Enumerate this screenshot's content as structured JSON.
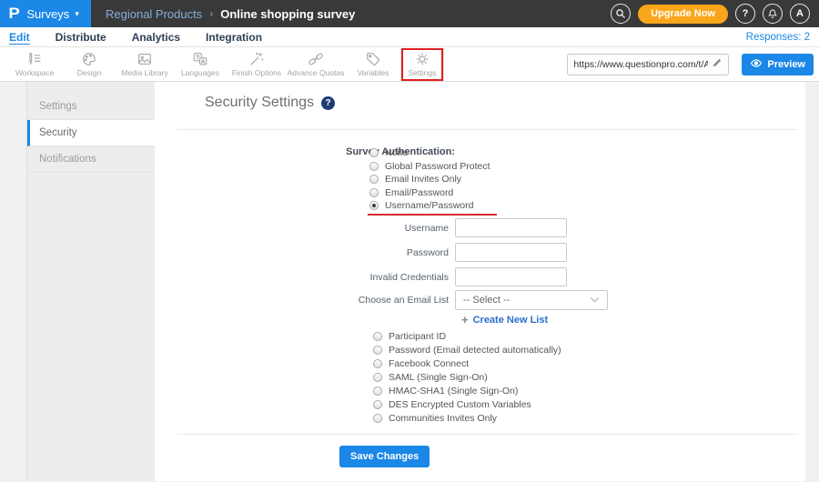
{
  "topbar": {
    "logo_letter": "P",
    "app_name": "Surveys",
    "caret": "▾",
    "breadcrumb_parent": "Regional Products",
    "breadcrumb_separator": "›",
    "breadcrumb_current": "Online shopping survey",
    "upgrade_label": "Upgrade Now",
    "help_label": "?",
    "avatar_label": "A"
  },
  "tabbar": {
    "tabs": [
      "Edit",
      "Distribute",
      "Analytics",
      "Integration"
    ],
    "active_tab": "Edit",
    "responses_label": "Responses: 2"
  },
  "toolbar": {
    "items": [
      "Workspace",
      "Design",
      "Media Library",
      "Languages",
      "Finish Options",
      "Advance Quotas",
      "Variables",
      "Settings"
    ],
    "highlighted_item": "Settings",
    "url_value": "https://www.questionpro.com/t/APNrfZ",
    "preview_label": "Preview"
  },
  "sidebar": {
    "items": [
      "Settings",
      "Security",
      "Notifications"
    ],
    "active_item": "Security"
  },
  "main": {
    "title": "Security Settings",
    "help_icon": "?",
    "auth_label": "Survey Authentication:",
    "auth_options_top": [
      "None",
      "Global Password Protect",
      "Email Invites Only",
      "Email/Password",
      "Username/Password"
    ],
    "selected_option": "Username/Password",
    "fields": [
      {
        "label": "Username",
        "value": ""
      },
      {
        "label": "Password",
        "value": ""
      },
      {
        "label": "Invalid Credentials",
        "value": ""
      }
    ],
    "email_list_label": "Choose an Email List",
    "email_list_selected": "-- Select --",
    "create_list_plus": "+",
    "create_list_label": "Create New List",
    "auth_options_bottom": [
      "Participant ID",
      "Password (Email detected automatically)",
      "Facebook Connect",
      "SAML (Single Sign-On)",
      "HMAC-SHA1 (Single Sign-On)",
      "DES Encrypted Custom Variables",
      "Communities Invites Only"
    ],
    "save_label": "Save Changes"
  },
  "colors": {
    "brand_blue": "#1b87e6",
    "topbar_dark": "#393939",
    "upgrade_orange": "#faa61a",
    "annotation_red": "#e02020",
    "selected_underline_red": "#d62b2b",
    "link_blue": "#2a6fc9",
    "help_badge_navy": "#1d3e75"
  }
}
